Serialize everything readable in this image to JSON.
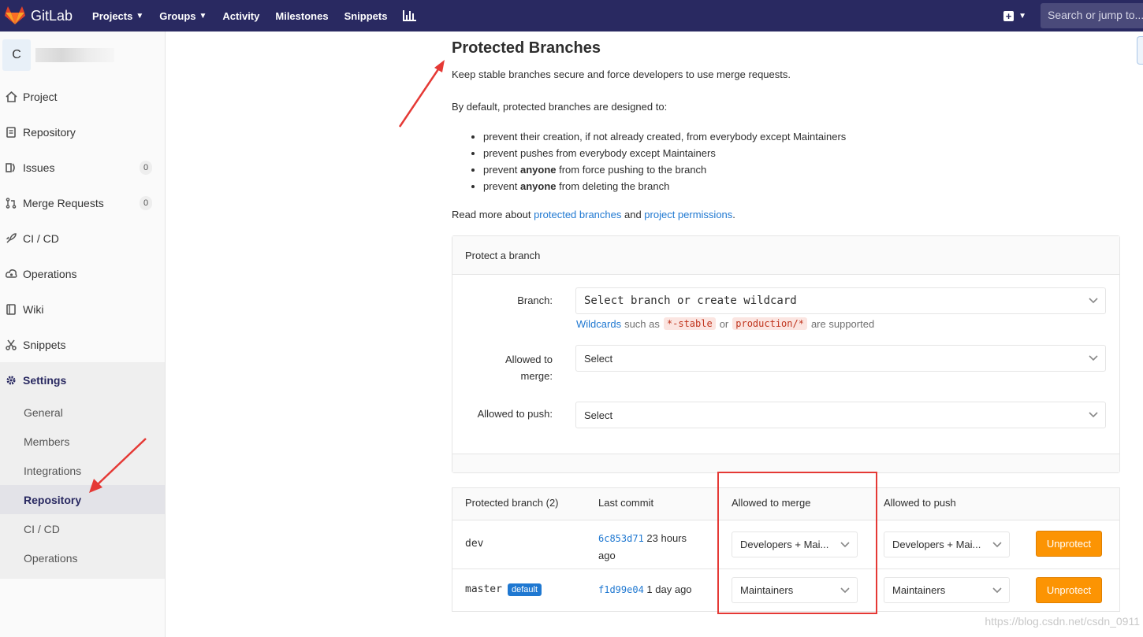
{
  "navbar": {
    "brand": "GitLab",
    "links": [
      {
        "label": "Projects",
        "caret": true
      },
      {
        "label": "Groups",
        "caret": true
      },
      {
        "label": "Activity",
        "caret": false
      },
      {
        "label": "Milestones",
        "caret": false
      },
      {
        "label": "Snippets",
        "caret": false
      }
    ],
    "search_placeholder": "Search or jump to..."
  },
  "sidebar": {
    "project_avatar_letter": "C",
    "items": [
      {
        "label": "Project",
        "icon": "home-icon"
      },
      {
        "label": "Repository",
        "icon": "doc-icon"
      },
      {
        "label": "Issues",
        "icon": "issues-icon",
        "badge": "0"
      },
      {
        "label": "Merge Requests",
        "icon": "merge-icon",
        "badge": "0"
      },
      {
        "label": "CI / CD",
        "icon": "rocket-icon"
      },
      {
        "label": "Operations",
        "icon": "cloud-icon"
      },
      {
        "label": "Wiki",
        "icon": "book-icon"
      },
      {
        "label": "Snippets",
        "icon": "scissors-icon"
      },
      {
        "label": "Settings",
        "icon": "gear-icon"
      }
    ],
    "settings_sub": [
      "General",
      "Members",
      "Integrations",
      "Repository",
      "CI / CD",
      "Operations"
    ]
  },
  "page": {
    "title": "Protected Branches",
    "intro": "Keep stable branches secure and force developers to use merge requests.",
    "default_text": "By default, protected branches are designed to:",
    "rules": [
      {
        "pre": "prevent their creation, if not already created, from everybody except Maintainers",
        "bold": "",
        "post": ""
      },
      {
        "pre": "prevent pushes from everybody except Maintainers",
        "bold": "",
        "post": ""
      },
      {
        "pre": "prevent ",
        "bold": "anyone",
        "post": " from force pushing to the branch"
      },
      {
        "pre": "prevent ",
        "bold": "anyone",
        "post": " from deleting the branch"
      }
    ],
    "read_more": {
      "pre": "Read more about ",
      "link1": "protected branches",
      "mid": " and ",
      "link2": "project permissions",
      "post": "."
    }
  },
  "protect_form": {
    "heading": "Protect a branch",
    "branch_label": "Branch:",
    "branch_placeholder": "Select branch or create wildcard",
    "help": {
      "link": "Wildcards",
      "pre": "such as",
      "code1": "*-stable",
      "or": "or",
      "code2": "production/*",
      "post": "are supported"
    },
    "merge_label_1": "Allowed to",
    "merge_label_2": "merge:",
    "merge_value": "Select",
    "push_label": "Allowed to push:",
    "push_value": "Select"
  },
  "table": {
    "headers": [
      "Protected branch (2)",
      "Last commit",
      "Allowed to merge",
      "Allowed to push"
    ],
    "rows": [
      {
        "branch": "dev",
        "default_badge": "",
        "sha": "6c853d71",
        "time_1": "23 hours",
        "time_2": "ago",
        "merge": "Developers + Mai...",
        "push": "Developers + Mai...",
        "action": "Unprotect"
      },
      {
        "branch": "master",
        "default_badge": "default",
        "sha": "f1d99e04",
        "time_1": "1 day ago",
        "time_2": "",
        "merge": "Maintainers",
        "push": "Maintainers",
        "action": "Unprotect"
      }
    ]
  },
  "watermark": "https://blog.csdn.net/csdn_0911",
  "colors": {
    "navbar": "#292961",
    "link": "#1f78d1",
    "unprotect": "#fc9403",
    "annotation": "#e53935"
  }
}
